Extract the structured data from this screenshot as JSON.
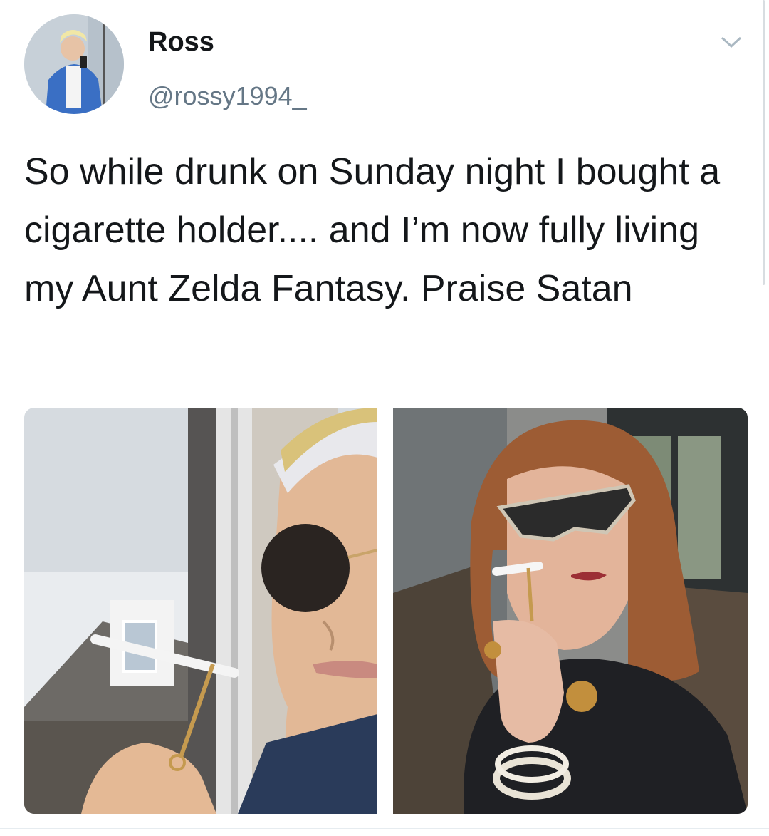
{
  "tweet": {
    "display_name": "Ross",
    "handle": "@rossy1994_",
    "text": "So while drunk on Sunday night I bought a cigarette holder.... and I’m now fully living my Aunt Zelda Fantasy. Praise Satan",
    "menu_icon": "chevron-down-icon"
  },
  "media": {
    "photos": [
      {
        "subject": "selfie-man-sunglasses-cigarette-holder"
      },
      {
        "subject": "woman-cat-eye-sunglasses-cigarette-holder"
      }
    ]
  },
  "colors": {
    "text": "#14171a",
    "secondary": "#657786",
    "accent_jacket": "#3a6fc4"
  }
}
